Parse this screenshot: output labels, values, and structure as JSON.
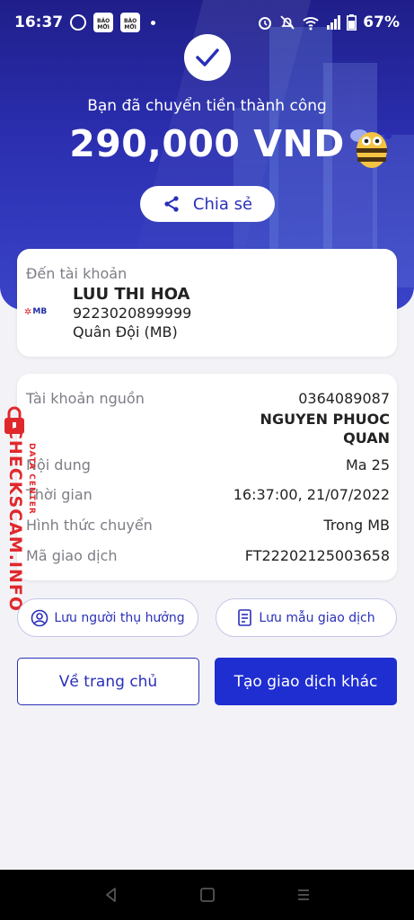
{
  "status_bar": {
    "time": "16:37",
    "baomoi_label": "BÁO MỚI",
    "battery": "67%",
    "icons": [
      "messenger-icon",
      "baomoi-icon",
      "baomoi-icon",
      "notification-dot",
      "alarm-icon",
      "mute-icon",
      "wifi-icon",
      "signal-icon",
      "battery-icon"
    ]
  },
  "header": {
    "success_text": "Bạn đã chuyển tiền thành công",
    "amount": "290,000 VND",
    "share_label": "Chia sẻ"
  },
  "destination": {
    "label": "Đến tài khoản",
    "bank_logo": "MB",
    "name": "LUU THI HOA",
    "account": "9223020899999",
    "bank": "Quân Đội (MB)"
  },
  "details": {
    "source_label": "Tài khoản nguồn",
    "source_account": "0364089087",
    "source_name": "NGUYEN PHUOC QUAN",
    "content_label": "Nội dung",
    "content_value": "Ma 25",
    "time_label": "Thời gian",
    "time_value": "16:37:00, 21/07/2022",
    "method_label": "Hình thức chuyển",
    "method_value": "Trong MB",
    "txn_label": "Mã giao dịch",
    "txn_value": "FT22202125003658"
  },
  "watermark": {
    "main": "CHECKSCAM.INFO",
    "sub": "DATA CENTER"
  },
  "actions": {
    "save_beneficiary": "Lưu người thụ hưởng",
    "save_template": "Lưu mẫu giao dịch",
    "home": "Về trang chủ",
    "new_transaction": "Tạo giao dịch khác"
  },
  "colors": {
    "primary": "#2a2fb8",
    "button_fill": "#1f2ed1",
    "watermark": "#e0282c"
  }
}
